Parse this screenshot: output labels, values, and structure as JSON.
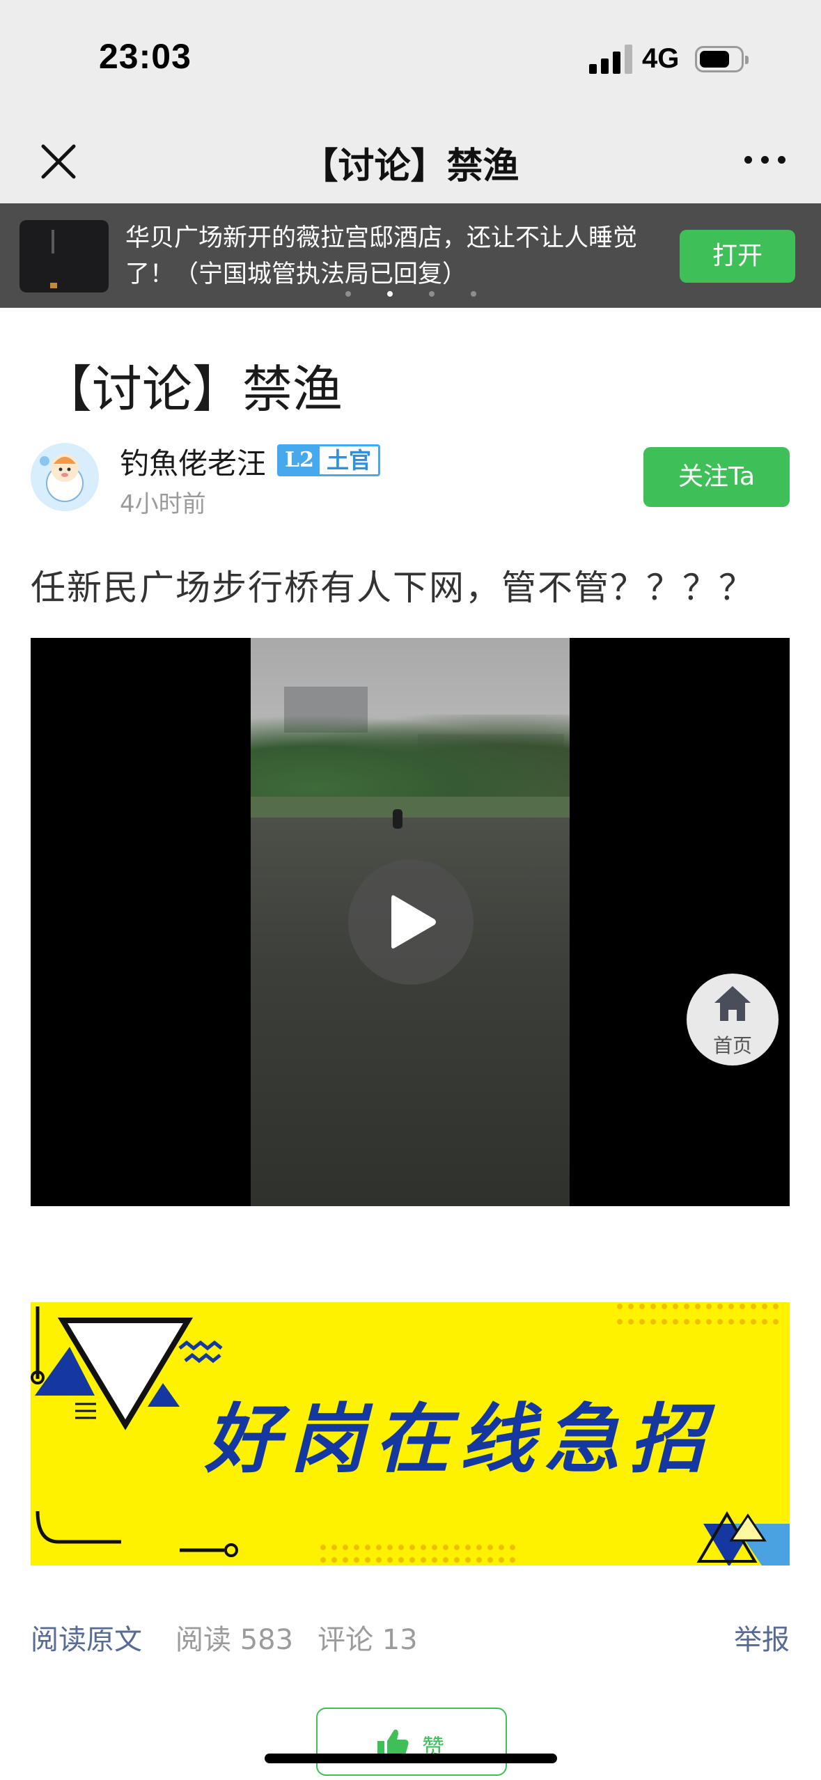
{
  "status_bar": {
    "time": "23:03",
    "network": "4G"
  },
  "nav": {
    "title": "【讨论】禁渔"
  },
  "banner": {
    "text": "华贝广场新开的薇拉宫邸酒店，还让不让人睡觉了！（宁国城管执法局已回复）",
    "open_label": "打开",
    "page_count": 4,
    "active_index": 1
  },
  "article": {
    "title": "【讨论】禁渔",
    "author": "钓魚佬老汪",
    "badge_level": "L2",
    "badge_rank": "土官",
    "time": "4小时前",
    "follow_label": "关注Ta",
    "body": "任新民广场步行桥有人下网，管不管？？？？"
  },
  "float_home": {
    "label": "首页"
  },
  "ad": {
    "text": "好岗在线急招"
  },
  "footer": {
    "read_original": "阅读原文",
    "read_label": "阅读",
    "read_count": "583",
    "comment_label": "评论",
    "comment_count": "13",
    "report": "举报",
    "like": "赞"
  },
  "colors": {
    "accent_green": "#3ebf58",
    "link_blue": "#576b95",
    "ad_yellow": "#fff200",
    "ad_blue": "#1438a0"
  }
}
